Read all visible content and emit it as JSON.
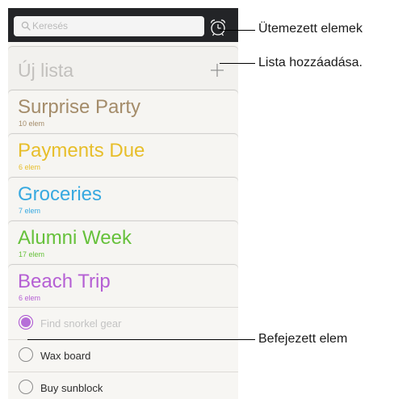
{
  "search": {
    "placeholder": "Keresés"
  },
  "new_list": {
    "label": "Új lista"
  },
  "lists": [
    {
      "title": "Surprise Party",
      "count": "10 elem",
      "color": "#a48c6a"
    },
    {
      "title": "Payments Due",
      "count": "6 elem",
      "color": "#e7be2a"
    },
    {
      "title": "Groceries",
      "count": "7 elem",
      "color": "#37a9e0"
    },
    {
      "title": "Alumni Week",
      "count": "17 elem",
      "color": "#66c13b"
    },
    {
      "title": "Beach Trip",
      "count": "6 elem",
      "color": "#b55fd4"
    }
  ],
  "items": [
    {
      "text": "Find snorkel gear",
      "completed": true
    },
    {
      "text": "Wax board",
      "completed": false
    },
    {
      "text": "Buy sunblock",
      "completed": false
    }
  ],
  "callouts": {
    "scheduled": "Ütemezett elemek",
    "add_list": "Lista hozzáadása.",
    "completed": "Befejezett elem"
  }
}
